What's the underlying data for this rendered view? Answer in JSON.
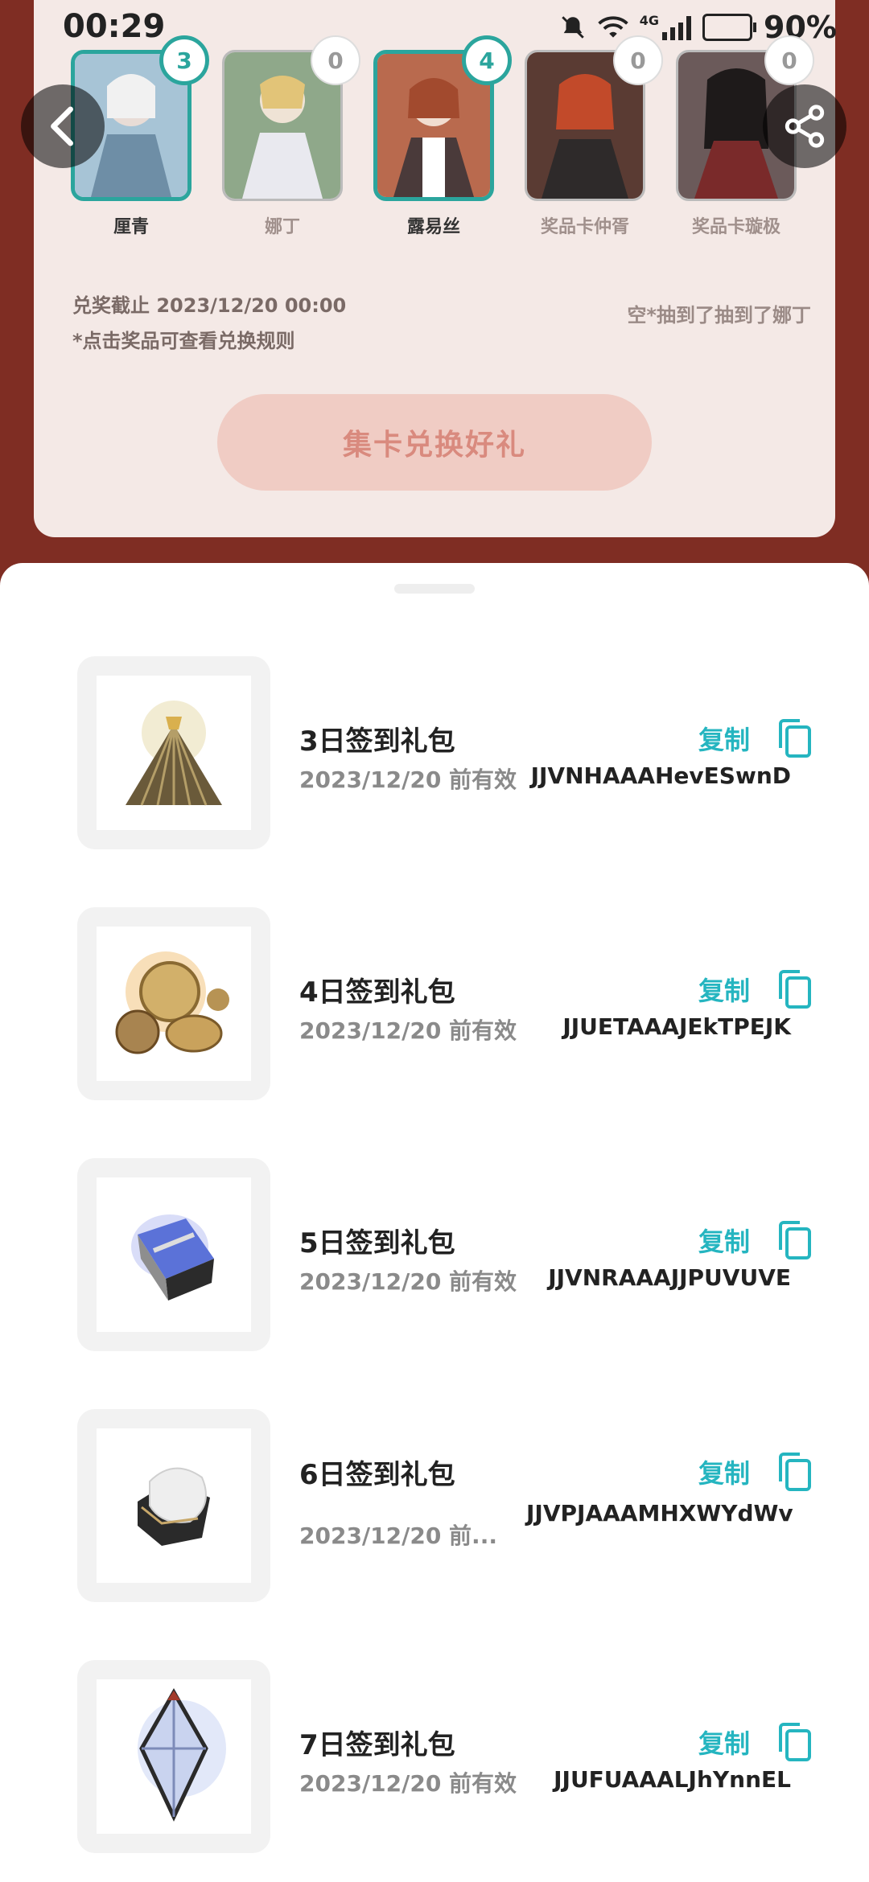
{
  "status_bar": {
    "time": "00:29",
    "battery": "90%",
    "network": "4G"
  },
  "cards": [
    {
      "name": "厘青",
      "count": "3",
      "active": true
    },
    {
      "name": "娜丁",
      "count": "0",
      "active": false
    },
    {
      "name": "露易丝",
      "count": "4",
      "active": true
    },
    {
      "name": "奖品卡仲胥",
      "count": "0",
      "active": false
    },
    {
      "name": "奖品卡璇极",
      "count": "0",
      "active": false
    }
  ],
  "info": {
    "deadline": "兑奖截止 2023/12/20 00:00",
    "rule_hint": "*点击奖品可查看兑换规则",
    "ticker": "空*抽到了抽到了娜丁"
  },
  "redeem_button": "集卡兑换好礼",
  "gifts": [
    {
      "title": "3日签到礼包",
      "valid": "2023/12/20 前有效",
      "code": "JJVNHAAAHevESwnD",
      "copy_label": "复制"
    },
    {
      "title": "4日签到礼包",
      "valid": "2023/12/20 前有效",
      "code": "JJUETAAAJEkTPEJK",
      "copy_label": "复制"
    },
    {
      "title": "5日签到礼包",
      "valid": "2023/12/20 前有效",
      "code": "JJVNRAAAJJPUVUVE",
      "copy_label": "复制"
    },
    {
      "title": "6日签到礼包",
      "valid": "2023/12/20 前...",
      "code": "JJVPJAAAMHXWYdWv",
      "copy_label": "复制"
    },
    {
      "title": "7日签到礼包",
      "valid": "2023/12/20 前有效",
      "code": "JJUFUAAALJhYnnEL",
      "copy_label": "复制"
    }
  ],
  "colors": {
    "accent": "#25b5c0",
    "active_card": "#2ba59d",
    "page_bg": "#7f2d23"
  }
}
